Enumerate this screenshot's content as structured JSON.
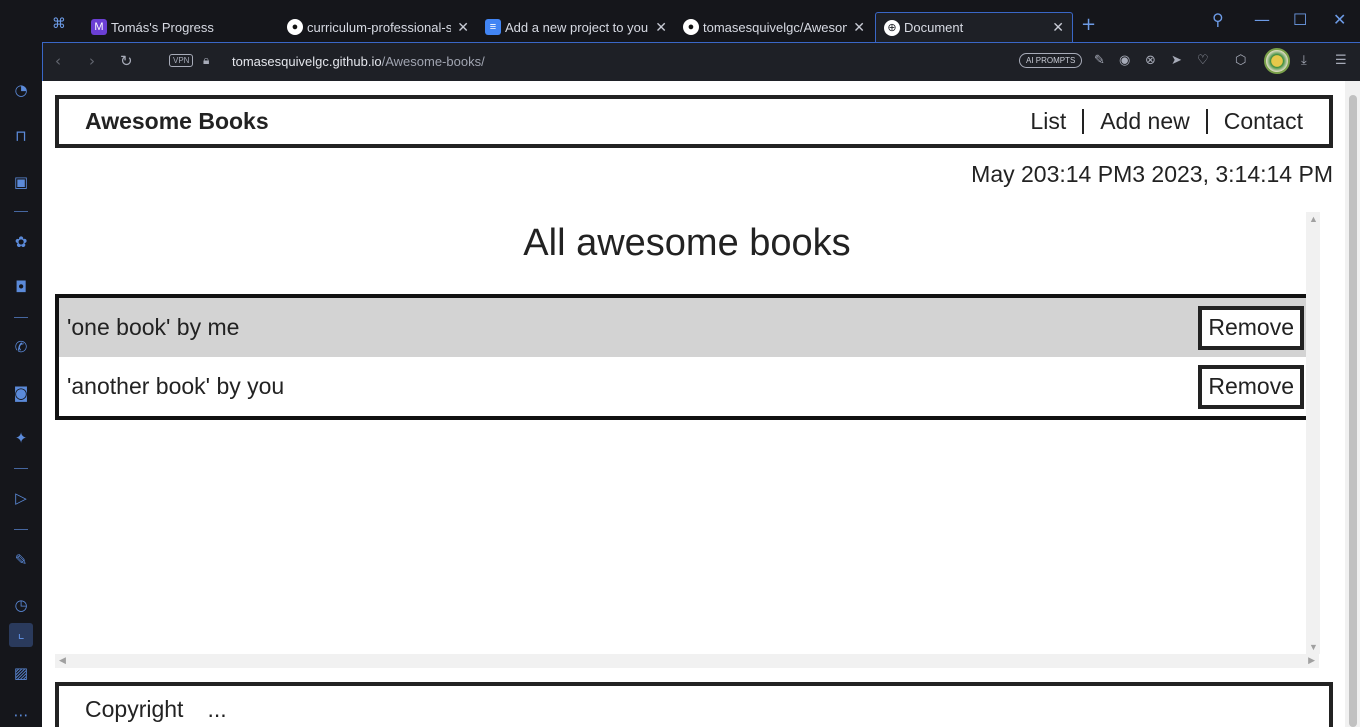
{
  "browser": {
    "tabs": [
      {
        "label": "Tomás's Progress",
        "icon": "microverse-icon",
        "active": false
      },
      {
        "label": "curriculum-professional-ski",
        "icon": "github-icon",
        "active": false
      },
      {
        "label": "Add a new project to your p",
        "icon": "document-icon",
        "active": false
      },
      {
        "label": "tomasesquivelgc/Awesome",
        "icon": "github-icon",
        "active": false
      },
      {
        "label": "Document",
        "icon": "globe-icon",
        "active": true
      }
    ],
    "url_host": "tomasesquivelgc.github.io",
    "url_path": "/Awesome-books/",
    "vpn_label": "VPN",
    "ai_prompts_label": "AI PROMPTS",
    "accent_color": "#3a67c7"
  },
  "site": {
    "brand": "Awesome Books",
    "nav": [
      "List",
      "Add new",
      "Contact"
    ],
    "date": "May 203:14 PM3 2023, 3:14:14 PM",
    "section_title": "All awesome books",
    "books": [
      {
        "text": "'one book' by me",
        "button": "Remove"
      },
      {
        "text": "'another book' by you",
        "button": "Remove"
      }
    ],
    "footer": {
      "copyright": "Copyright",
      "ellipsis": "..."
    }
  }
}
